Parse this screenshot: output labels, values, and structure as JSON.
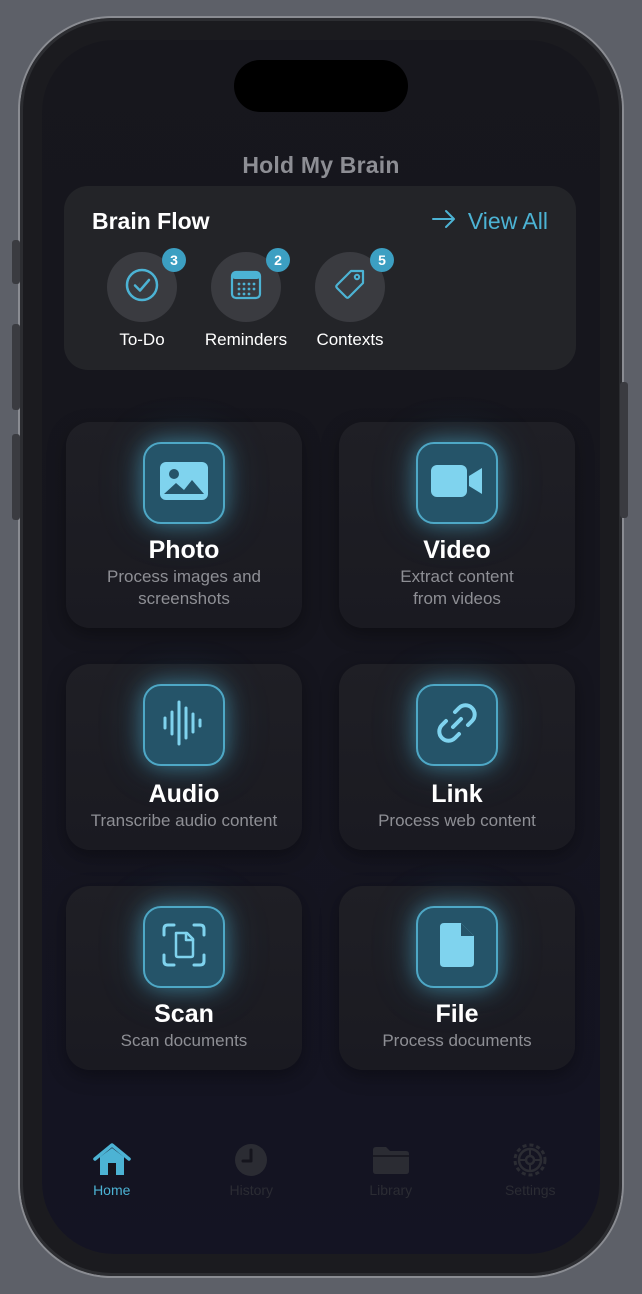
{
  "app": {
    "title": "Hold My Brain"
  },
  "brain_flow": {
    "title": "Brain Flow",
    "view_all": "View All",
    "items": [
      {
        "label": "To-Do",
        "count": "3",
        "icon": "checkmark-circle-icon"
      },
      {
        "label": "Reminders",
        "count": "2",
        "icon": "calendar-icon"
      },
      {
        "label": "Contexts",
        "count": "5",
        "icon": "tag-icon"
      }
    ]
  },
  "actions": [
    {
      "title": "Photo",
      "description": "Process images and screenshots",
      "icon": "photo-icon"
    },
    {
      "title": "Video",
      "description": "Extract content from videos",
      "icon": "video-camera-icon"
    },
    {
      "title": "Audio",
      "description": "Transcribe audio content",
      "icon": "waveform-icon"
    },
    {
      "title": "Link",
      "description": "Process web content",
      "icon": "link-icon"
    },
    {
      "title": "Scan",
      "description": "Scan documents",
      "icon": "document-scanner-icon"
    },
    {
      "title": "File",
      "description": "Process documents",
      "icon": "file-icon"
    }
  ],
  "tabbar": {
    "tabs": [
      {
        "label": "Home",
        "icon": "house-icon",
        "active": true
      },
      {
        "label": "History",
        "icon": "clock-icon",
        "active": false
      },
      {
        "label": "Library",
        "icon": "folder-icon",
        "active": false
      },
      {
        "label": "Settings",
        "icon": "gear-icon",
        "active": false
      }
    ]
  },
  "colors": {
    "accent": "#4cb3d4",
    "background": "#15151d",
    "card": "#232428",
    "badge": "#3c9fc2"
  }
}
